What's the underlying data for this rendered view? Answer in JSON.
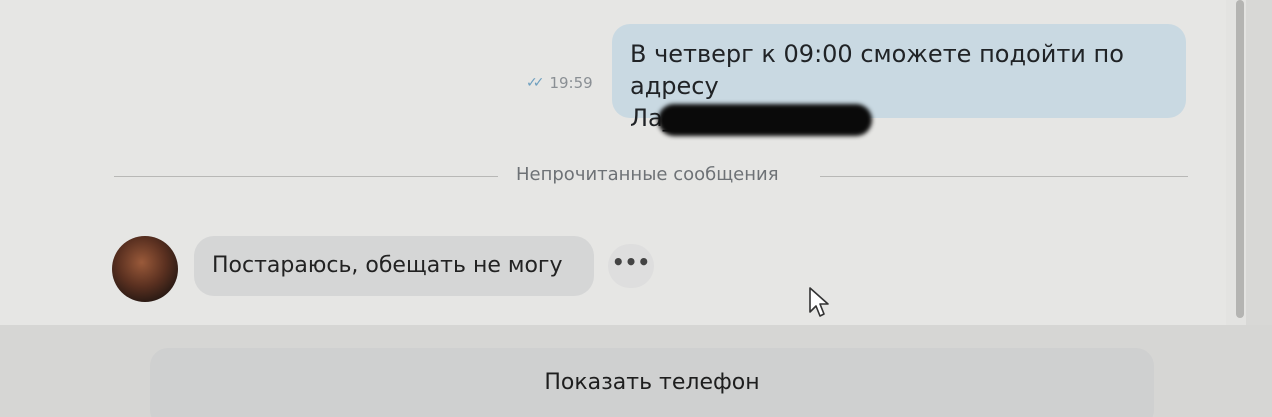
{
  "chat": {
    "outgoing_message": {
      "line1": "В четверг к 09:00 сможете подойти по адресу",
      "line2": "Ла________1?",
      "time": "19:59",
      "status_icon": "double-check-icon"
    },
    "unread_divider": {
      "label": "Непрочитанные сообщения"
    },
    "incoming_message": {
      "text": "Постараюсь, обещать не могу",
      "more_label": "•••"
    }
  },
  "footer": {
    "show_phone_label": "Показать телефон"
  }
}
